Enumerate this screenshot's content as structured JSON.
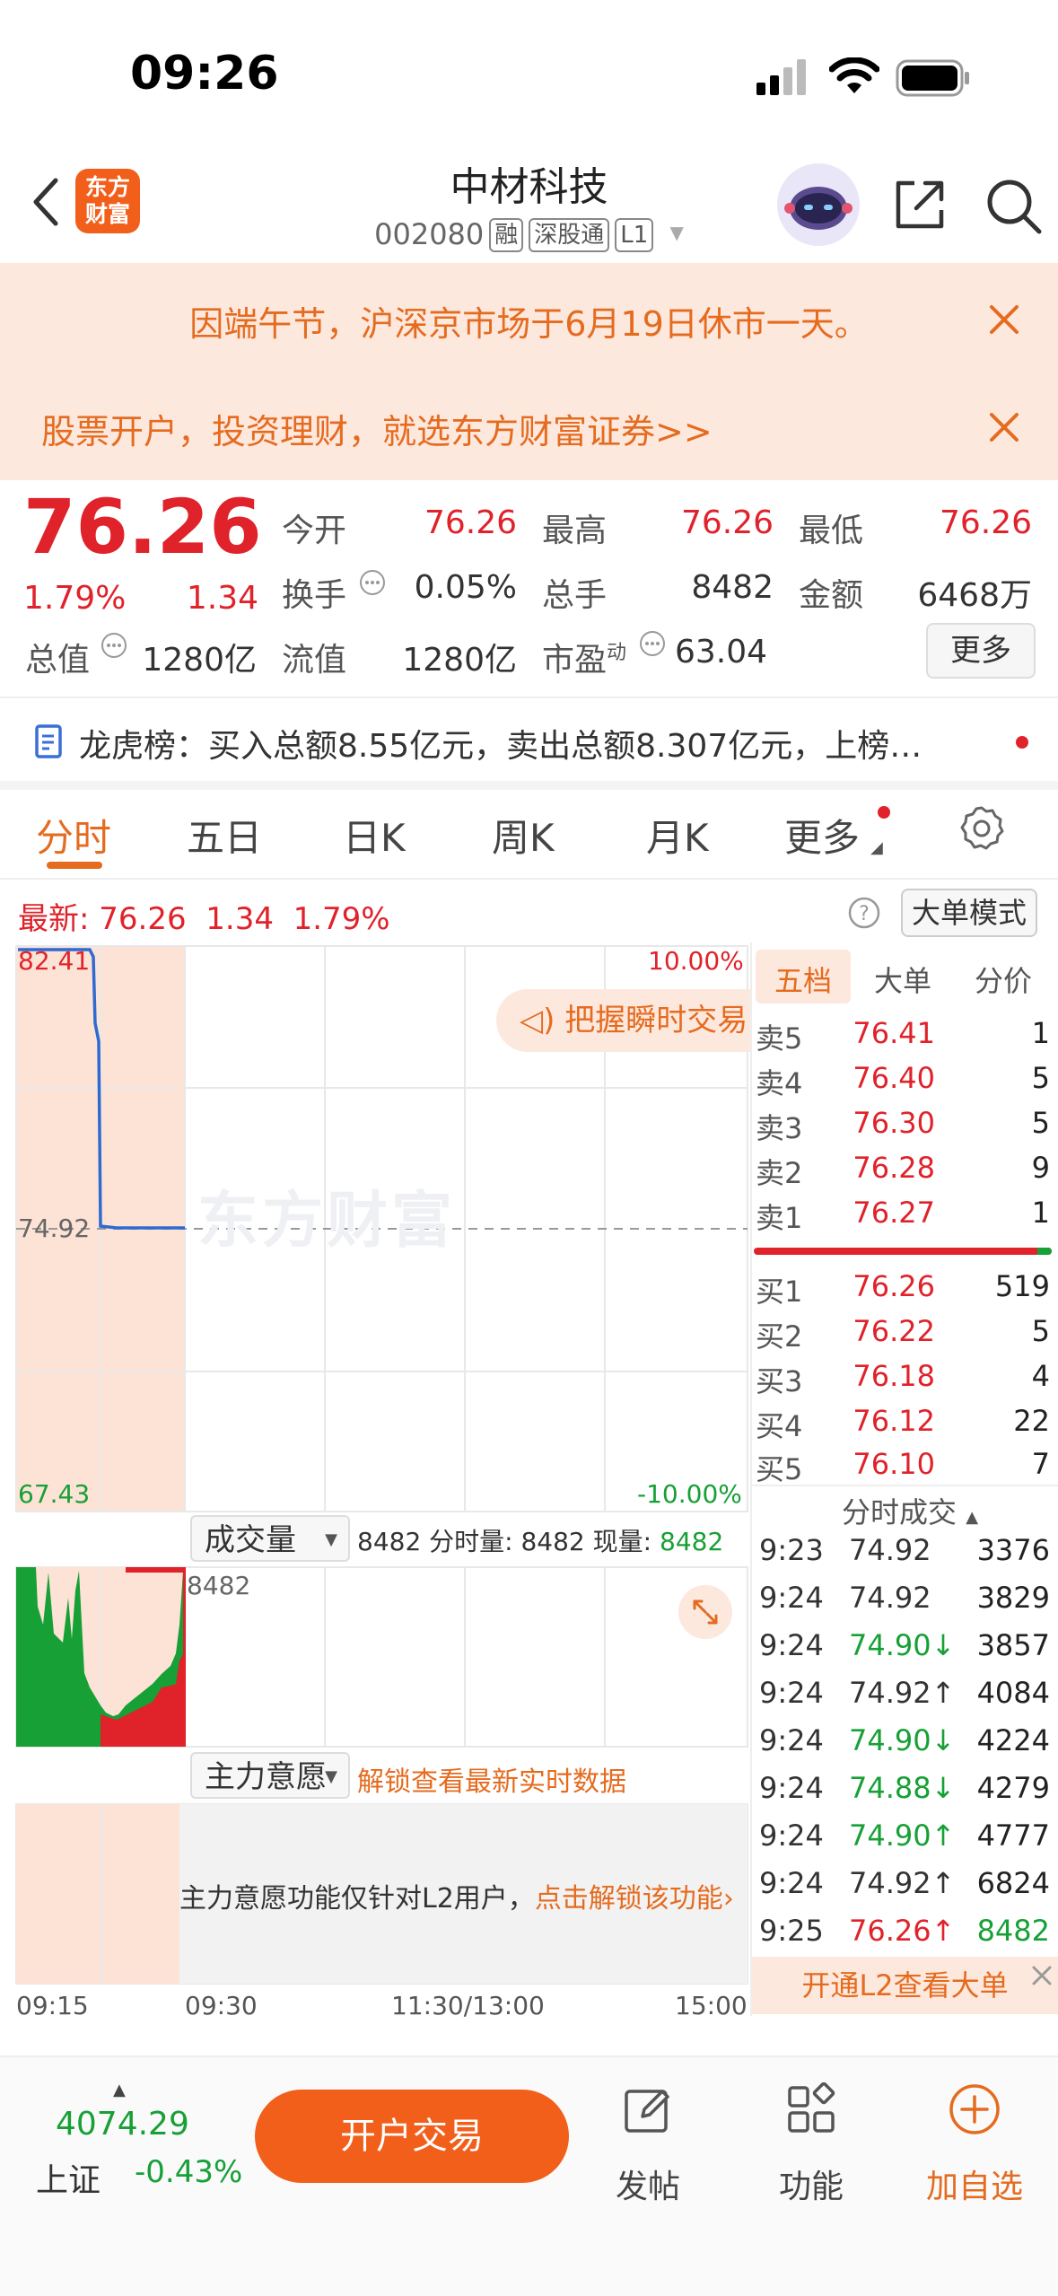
{
  "status": {
    "time": "09:26"
  },
  "header": {
    "logo_line1": "东方",
    "logo_line2": "财富",
    "stock_name": "中材科技",
    "stock_code": "002080",
    "tag_rong": "融",
    "tag_sgt": "深股通",
    "tag_l1": "L1"
  },
  "banners": [
    {
      "text": "因端午节，沪深京市场于6月19日休市一天。"
    },
    {
      "text": "股票开户，投资理财，就选东方财富证券>>"
    }
  ],
  "quote": {
    "price": "76.26",
    "change_pct": "1.79%",
    "change_abs": "1.34",
    "open_label": "今开",
    "open": "76.26",
    "high_label": "最高",
    "high": "76.26",
    "low_label": "最低",
    "low": "76.26",
    "turnover_label": "换手",
    "turnover": "0.05%",
    "volume_label": "总手",
    "volume": "8482",
    "amount_label": "金额",
    "amount": "6468万",
    "mktcap_label": "总值",
    "mktcap": "1280亿",
    "float_label": "流值",
    "float": "1280亿",
    "pe_label": "市盈",
    "pe_sup": "动",
    "pe": "63.04",
    "more_label": "更多"
  },
  "lhb": {
    "text": "龙虎榜：买入总额8.55亿元，卖出总额8.307亿元，上榜…"
  },
  "tabs": [
    "分时",
    "五日",
    "日K",
    "周K",
    "月K",
    "更多"
  ],
  "chart": {
    "latest_label": "最新:",
    "latest_price": "76.26",
    "latest_chg": "1.34",
    "latest_pct": "1.79%",
    "big_mode": "大单模式",
    "y_top": "82.41",
    "y_mid": "74.92",
    "y_bottom": "67.43",
    "pct_top": "10.00%",
    "pct_bottom": "-10.00%",
    "pill_text": "把握瞬时交易",
    "watermark": "东方财富",
    "vol_select": "成交量",
    "vol_info_prefix": "8482 分时量: 8482 现量: ",
    "vol_info_now": "8482",
    "vol_max": "8482",
    "main_select": "主力意愿",
    "unlock_text": "解锁查看最新实时数据",
    "l2_note": "主力意愿功能仅针对L2用户，",
    "l2_link": "点击解锁该功能",
    "times": [
      "09:15",
      "09:30",
      "11:30/13:00",
      "15:00"
    ]
  },
  "orderbook": {
    "tabs": [
      "五档",
      "大单",
      "分价"
    ],
    "asks": [
      {
        "label": "卖5",
        "price": "76.41",
        "vol": "1"
      },
      {
        "label": "卖4",
        "price": "76.40",
        "vol": "5"
      },
      {
        "label": "卖3",
        "price": "76.30",
        "vol": "5"
      },
      {
        "label": "卖2",
        "price": "76.28",
        "vol": "9"
      },
      {
        "label": "卖1",
        "price": "76.27",
        "vol": "1"
      }
    ],
    "bids": [
      {
        "label": "买1",
        "price": "76.26",
        "vol": "519"
      },
      {
        "label": "买2",
        "price": "76.22",
        "vol": "5"
      },
      {
        "label": "买3",
        "price": "76.18",
        "vol": "4"
      },
      {
        "label": "买4",
        "price": "76.12",
        "vol": "22"
      },
      {
        "label": "买5",
        "price": "76.10",
        "vol": "7"
      }
    ],
    "trades_title": "分时成交",
    "trades": [
      {
        "time": "9:23",
        "price": "74.92",
        "vol": "3376",
        "color": "#333333",
        "vcolor": "#222222"
      },
      {
        "time": "9:24",
        "price": "74.92",
        "vol": "3829",
        "color": "#333333",
        "vcolor": "#222222"
      },
      {
        "time": "9:24",
        "price": "74.90↓",
        "vol": "3857",
        "color": "#17a036",
        "vcolor": "#222222"
      },
      {
        "time": "9:24",
        "price": "74.92↑",
        "vol": "4084",
        "color": "#333333",
        "vcolor": "#222222"
      },
      {
        "time": "9:24",
        "price": "74.90↓",
        "vol": "4224",
        "color": "#17a036",
        "vcolor": "#222222"
      },
      {
        "time": "9:24",
        "price": "74.88↓",
        "vol": "4279",
        "color": "#17a036",
        "vcolor": "#222222"
      },
      {
        "time": "9:24",
        "price": "74.90↑",
        "vol": "4777",
        "color": "#17a036",
        "vcolor": "#222222"
      },
      {
        "time": "9:24",
        "price": "74.92↑",
        "vol": "6824",
        "color": "#333333",
        "vcolor": "#222222"
      },
      {
        "time": "9:25",
        "price": "76.26↑",
        "vol": "8482",
        "color": "#e0222a",
        "vcolor": "#17a036"
      }
    ],
    "l2_button": "开通L2查看大单"
  },
  "bottom": {
    "index_value": "4074.29",
    "index_name": "上证",
    "index_change": "-0.43%",
    "trade_button": "开户交易",
    "post": "发帖",
    "function": "功能",
    "add_watch": "加自选"
  }
}
